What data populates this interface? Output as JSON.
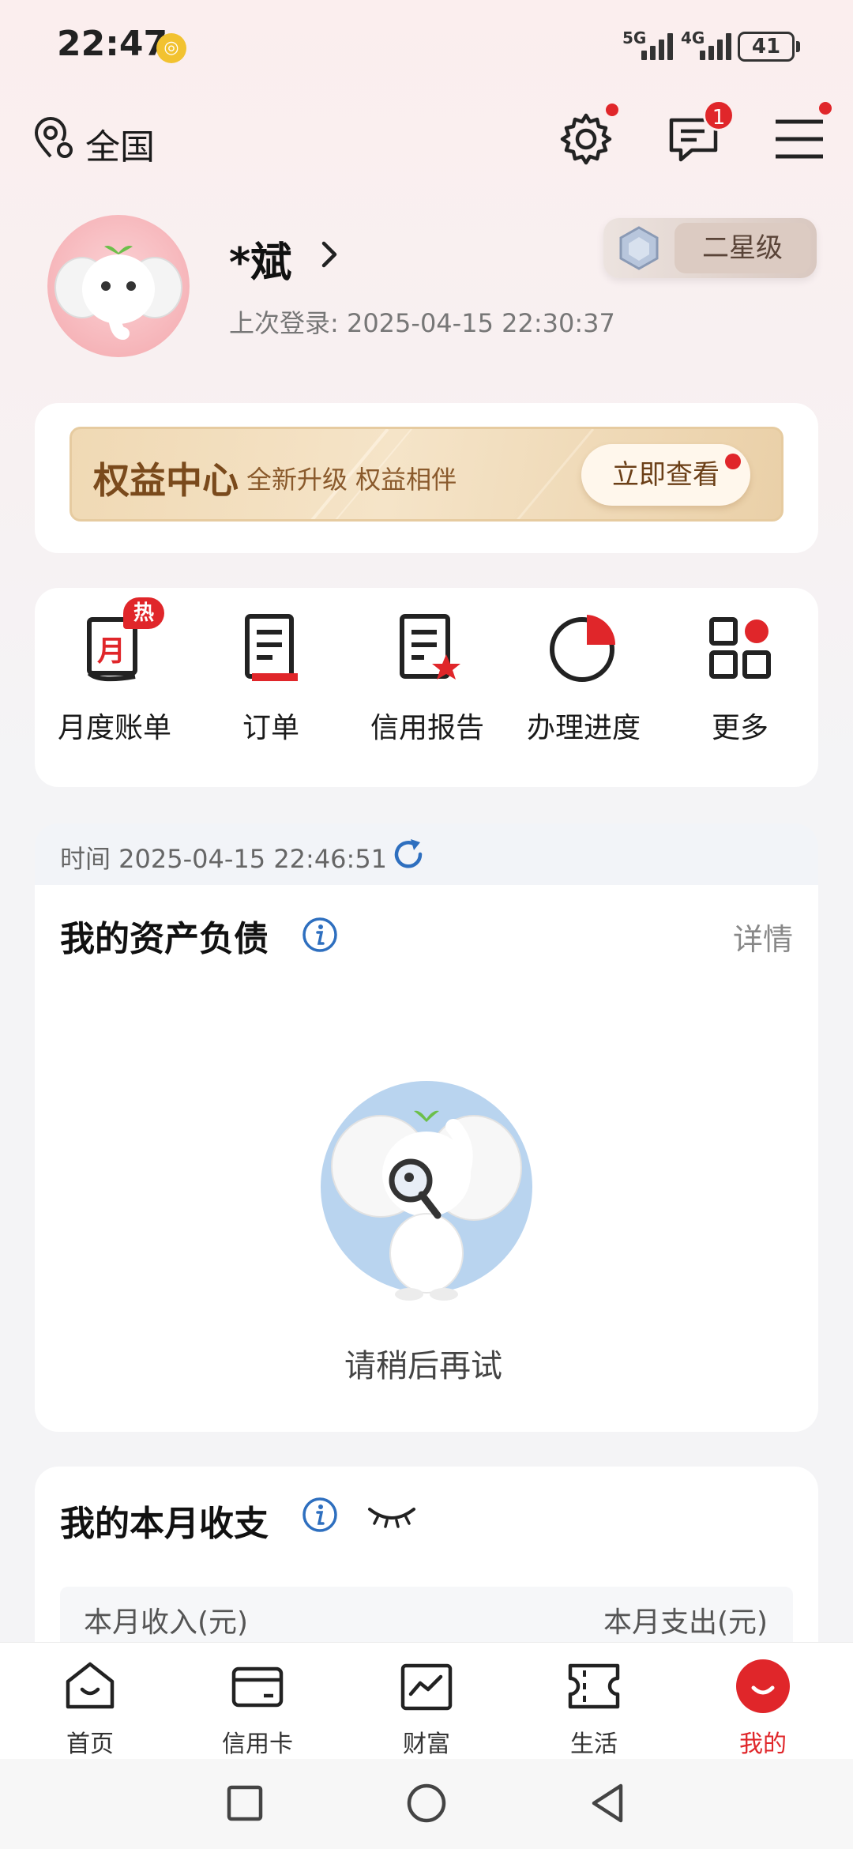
{
  "status_bar": {
    "time": "22:47",
    "net1": "5G",
    "net2": "4G",
    "battery": "41"
  },
  "header": {
    "location": "全国",
    "message_badge": "1"
  },
  "profile": {
    "name": "*斌",
    "last_login": "上次登录: 2025-04-15 22:30:37",
    "level": "二星级"
  },
  "rights": {
    "title": "权益中心",
    "subtitle": "全新升级 权益相伴",
    "button": "立即查看"
  },
  "quick_menu": {
    "hot": "热",
    "month_icon_char": "月",
    "items": [
      {
        "label": "月度账单",
        "icon": "monthly-bill-icon"
      },
      {
        "label": "订单",
        "icon": "order-icon"
      },
      {
        "label": "信用报告",
        "icon": "credit-report-icon"
      },
      {
        "label": "办理进度",
        "icon": "progress-icon"
      },
      {
        "label": "更多",
        "icon": "more-grid-icon"
      }
    ]
  },
  "assets": {
    "time": "时间 2025-04-15 22:46:51",
    "title": "我的资产负债",
    "detail": "详情",
    "empty_text": "请稍后再试"
  },
  "monthly": {
    "title": "我的本月收支",
    "income_label": "本月收入(元)",
    "expense_label": "本月支出(元)"
  },
  "bottom_nav": {
    "items": [
      {
        "label": "首页",
        "icon": "home-icon"
      },
      {
        "label": "信用卡",
        "icon": "credit-card-icon"
      },
      {
        "label": "财富",
        "icon": "wealth-icon"
      },
      {
        "label": "生活",
        "icon": "life-ticket-icon"
      },
      {
        "label": "我的",
        "icon": "mine-icon"
      }
    ],
    "active": "我的"
  },
  "colors": {
    "accent": "#e0262a",
    "gold": "#7a4a1c",
    "blue": "#2e6fbf"
  }
}
